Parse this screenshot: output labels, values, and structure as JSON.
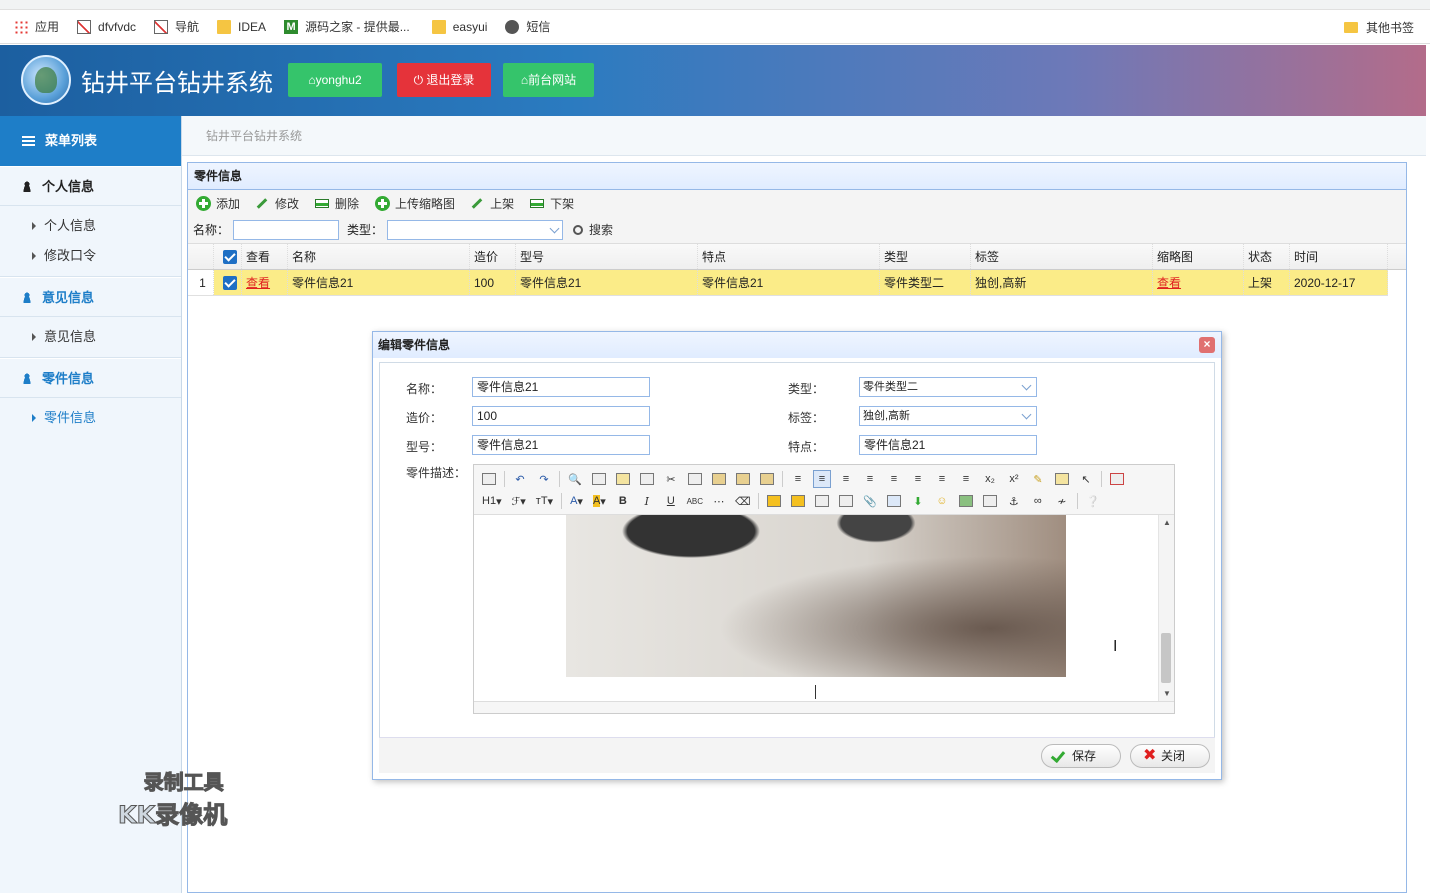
{
  "bookmarks": {
    "items": [
      "应用",
      "dfvfvdc",
      "导航",
      "IDEA",
      "源码之家 - 提供最...",
      "easyui",
      "短信"
    ],
    "other": "其他书签"
  },
  "header": {
    "title": "钻井平台钻井系统",
    "user_btn": "yonghu2",
    "logout_btn": "退出登录",
    "front_btn": "前台网站"
  },
  "sidebar": {
    "head": "菜单列表",
    "groups": [
      {
        "label": "个人信息",
        "items": [
          "个人信息",
          "修改口令"
        ]
      },
      {
        "label": "意见信息",
        "items": [
          "意见信息"
        ]
      },
      {
        "label": "零件信息",
        "items": [
          "零件信息"
        ]
      }
    ]
  },
  "breadcrumb": "钻井平台钻井系统",
  "panel": {
    "title": "零件信息",
    "toolbar": [
      "添加",
      "修改",
      "删除",
      "上传缩略图",
      "上架",
      "下架"
    ],
    "search": {
      "name_label": "名称：",
      "type_label": "类型：",
      "button": "搜索"
    },
    "columns": [
      "查看",
      "名称",
      "造价",
      "型号",
      "特点",
      "类型",
      "标签",
      "缩略图",
      "状态",
      "时间"
    ],
    "rows": [
      {
        "index": "1",
        "view": "查看",
        "name": "零件信息21",
        "price": "100",
        "model": "零件信息21",
        "feature": "零件信息21",
        "type": "零件类型二",
        "tags": "独创,高新",
        "thumb": "查看",
        "status": "上架",
        "time": "2020-12-17"
      }
    ]
  },
  "dialog": {
    "title": "编辑零件信息",
    "labels": {
      "name": "名称：",
      "price": "造价：",
      "model": "型号：",
      "desc": "零件描述：",
      "type": "类型：",
      "tags": "标签：",
      "feature": "特点："
    },
    "values": {
      "name": "零件信息21",
      "price": "100",
      "model": "零件信息21",
      "type": "零件类型二",
      "tags": "独创,高新",
      "feature": "零件信息21"
    },
    "save": "保存",
    "close": "关闭"
  },
  "editor_toolbar": {
    "heading": "H1",
    "font": "ℱ",
    "size": "тT",
    "fontcolor": "A",
    "bold": "B",
    "italic": "I",
    "underline": "U",
    "strike": "ABC"
  },
  "watermark": {
    "line1": "录制工具",
    "line2": "KK录像机"
  }
}
